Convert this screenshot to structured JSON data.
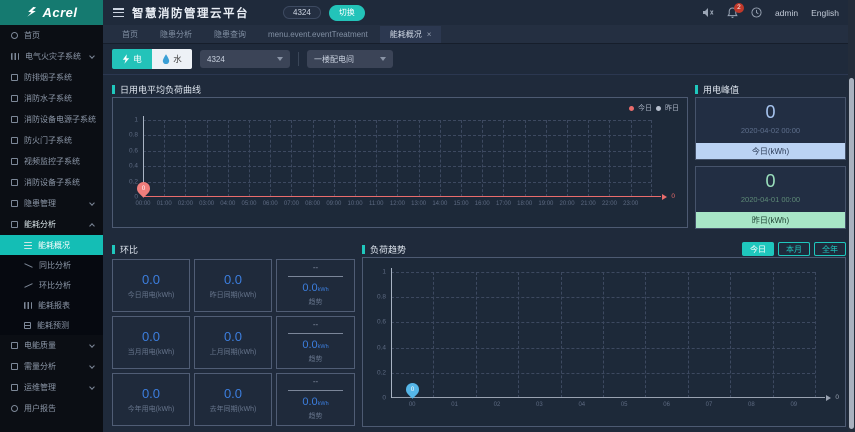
{
  "app": {
    "logo": "Acrel",
    "title": "智慧消防管理云平台",
    "badge": "4324",
    "switch_label": "切换",
    "bell_count": "2",
    "user": "admin",
    "language": "English"
  },
  "tabs": {
    "items": [
      "首页",
      "隐患分析",
      "隐患查询",
      "menu.event.eventTreatment",
      "能耗概况"
    ],
    "close": "×"
  },
  "filters": {
    "electric": "电",
    "water": "水",
    "device_select": "4324",
    "room_select": "一楼配电间"
  },
  "sidebar": {
    "items": [
      {
        "label": "首页"
      },
      {
        "label": "电气火灾子系统"
      },
      {
        "label": "防排烟子系统"
      },
      {
        "label": "消防水子系统"
      },
      {
        "label": "消防设备电源子系统"
      },
      {
        "label": "防火门子系统"
      },
      {
        "label": "视频监控子系统"
      },
      {
        "label": "消防设备子系统"
      },
      {
        "label": "隐患管理"
      },
      {
        "label": "能耗分析"
      },
      {
        "label": "电能质量"
      },
      {
        "label": "需量分析"
      },
      {
        "label": "运维管理"
      },
      {
        "label": "用户报告"
      }
    ],
    "submenu": [
      {
        "label": "能耗概况"
      },
      {
        "label": "同比分析"
      },
      {
        "label": "环比分析"
      },
      {
        "label": "能耗报表"
      },
      {
        "label": "能耗预测"
      }
    ]
  },
  "panels": {
    "load_curve": {
      "title": "日用电平均负荷曲线",
      "legend": [
        "今日",
        "昨日"
      ]
    },
    "peak": {
      "title": "用电峰值",
      "cards": [
        {
          "value": "0",
          "date": "2020-04-02 00:00",
          "label": "今日(kWh)"
        },
        {
          "value": "0",
          "date": "2020-04-01 00:00",
          "label": "昨日(kWh)"
        }
      ]
    },
    "huanbi": {
      "title": "环比",
      "rows": [
        {
          "left": {
            "value": "0.0",
            "label": "今日用电(kWh)"
          },
          "mid": {
            "value": "0.0",
            "label": "昨日同期(kWh)"
          },
          "trend": {
            "top": "--",
            "value": "0.0",
            "unit": "kWh",
            "label": "趋势"
          }
        },
        {
          "left": {
            "value": "0.0",
            "label": "当月用电(kWh)"
          },
          "mid": {
            "value": "0.0",
            "label": "上月同期(kWh)"
          },
          "trend": {
            "top": "--",
            "value": "0.0",
            "unit": "kWh",
            "label": "趋势"
          }
        },
        {
          "left": {
            "value": "0.0",
            "label": "今年用电(kWh)"
          },
          "mid": {
            "value": "0.0",
            "label": "去年同期(kWh)"
          },
          "trend": {
            "top": "--",
            "value": "0.0",
            "unit": "kWh",
            "label": "趋势"
          }
        }
      ]
    },
    "load_trend": {
      "title": "负荷趋势",
      "buttons": [
        "今日",
        "本月",
        "全年"
      ]
    }
  },
  "chart_data": [
    {
      "type": "line",
      "title": "日用电平均负荷曲线",
      "x_labels": [
        "00:00",
        "01:00",
        "02:00",
        "03:00",
        "04:00",
        "05:00",
        "06:00",
        "07:00",
        "08:00",
        "09:00",
        "10:00",
        "11:00",
        "12:00",
        "13:00",
        "14:00",
        "15:00",
        "16:00",
        "17:00",
        "18:00",
        "19:00",
        "20:00",
        "21:00",
        "22:00",
        "23:00"
      ],
      "y_ticks": [
        "1",
        "0.8",
        "0.6",
        "0.4",
        "0.2",
        "0"
      ],
      "ylim": [
        0,
        1
      ],
      "grid": "dashed",
      "legend": [
        "今日",
        "昨日"
      ],
      "legend_colors": [
        "#e96c6c",
        "#b7c0ce"
      ],
      "legend_position": "top-right",
      "series": [
        {
          "name": "今日",
          "values": [
            0
          ]
        },
        {
          "name": "昨日",
          "values": []
        }
      ],
      "axis_line_color": "#e96c6c",
      "end_label": "0",
      "label_mode": "tick",
      "marker": {
        "x": "00:00",
        "value": "0",
        "color": "#ef7d7b"
      }
    },
    {
      "type": "line",
      "title": "负荷趋势",
      "x_labels": [
        "00",
        "01",
        "02",
        "03",
        "04",
        "05",
        "06",
        "07",
        "08",
        "09"
      ],
      "y_ticks": [
        "1",
        "0.8",
        "0.6",
        "0.4",
        "0.2",
        "0"
      ],
      "ylim": [
        0,
        1
      ],
      "grid": "dashed",
      "series": [
        {
          "name": "今日",
          "values": [
            0
          ]
        }
      ],
      "axis_line_color": "#99a2b1",
      "end_label": "0",
      "label_mode": "slot",
      "marker": {
        "x": "00",
        "value": "0",
        "color": "#55b6e8"
      }
    }
  ]
}
